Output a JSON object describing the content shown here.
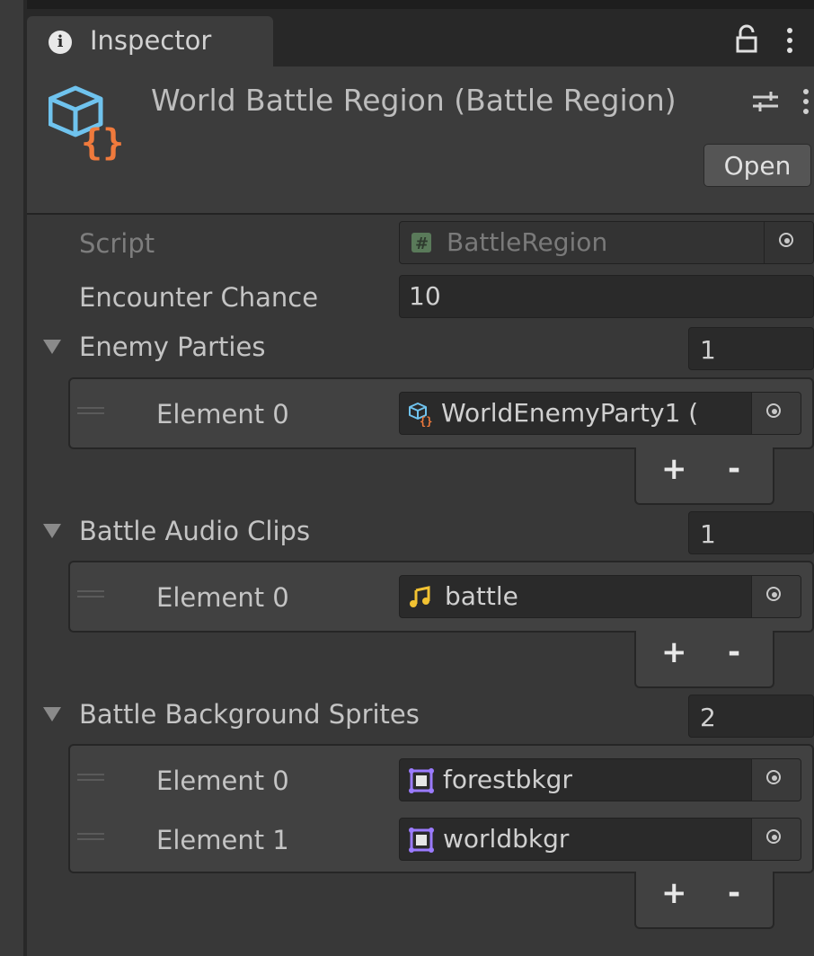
{
  "tab": {
    "label": "Inspector"
  },
  "header": {
    "title": "World Battle Region (Battle Region)",
    "open_label": "Open"
  },
  "fields": {
    "script_label": "Script",
    "script_value": "BattleRegion",
    "encounter_label": "Encounter Chance",
    "encounter_value": "10"
  },
  "lists": [
    {
      "label": "Enemy Parties",
      "size": "1",
      "elements": [
        {
          "label": "Element 0",
          "value": "WorldEnemyParty1 (",
          "icon": "scriptable-object-icon"
        }
      ]
    },
    {
      "label": "Battle Audio Clips",
      "size": "1",
      "elements": [
        {
          "label": "Element 0",
          "value": "battle",
          "icon": "audio-clip-icon"
        }
      ]
    },
    {
      "label": "Battle Background Sprites",
      "size": "2",
      "elements": [
        {
          "label": "Element 0",
          "value": "forestbkgr",
          "icon": "sprite-icon"
        },
        {
          "label": "Element 1",
          "value": "worldbkgr",
          "icon": "sprite-icon"
        }
      ]
    }
  ],
  "list_controls": {
    "add": "+",
    "remove": "-"
  },
  "colors": {
    "background": "#383838",
    "field": "#2a2a2a",
    "icon_blue": "#6fc3ee",
    "icon_orange": "#f07a3c",
    "audio_yellow": "#f2c232",
    "sprite_purple": "#9b7bff"
  }
}
